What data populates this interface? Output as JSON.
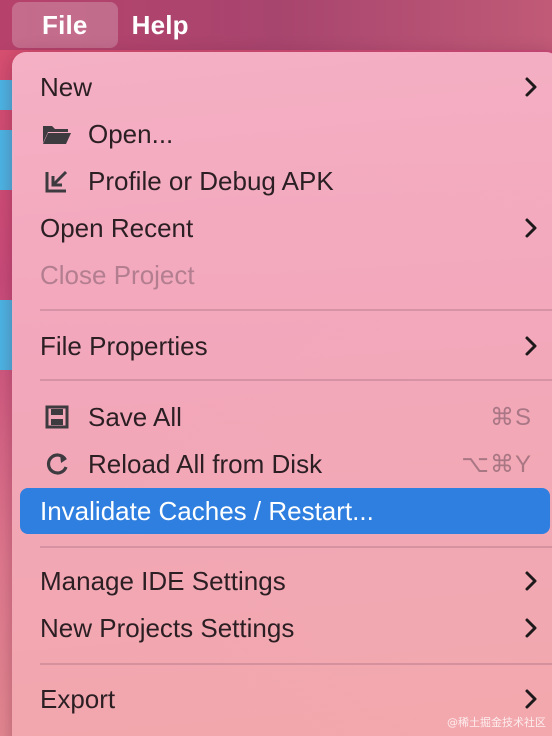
{
  "menubar": {
    "items": [
      {
        "label": "File"
      },
      {
        "label": "Help"
      }
    ]
  },
  "menu": {
    "items": [
      {
        "label": "New",
        "submenu": true
      },
      {
        "label": "Open...",
        "icon": "folder-icon"
      },
      {
        "label": "Profile or Debug APK",
        "icon": "import-arrow-icon"
      },
      {
        "label": "Open Recent",
        "submenu": true
      },
      {
        "label": "Close Project",
        "disabled": true
      },
      {
        "label": "File Properties",
        "submenu": true
      },
      {
        "label": "Save All",
        "icon": "save-icon",
        "shortcut": "⌘S"
      },
      {
        "label": "Reload All from Disk",
        "icon": "reload-icon",
        "shortcut": "⌥⌘Y"
      },
      {
        "label": "Invalidate Caches / Restart...",
        "highlighted": true
      },
      {
        "label": "Manage IDE Settings",
        "submenu": true
      },
      {
        "label": "New Projects Settings",
        "submenu": true
      },
      {
        "label": "Export",
        "submenu": true
      }
    ]
  },
  "colors": {
    "highlight": "#2f7fe0",
    "menubar": "#b6426b"
  },
  "watermark": "@稀土掘金技术社区"
}
